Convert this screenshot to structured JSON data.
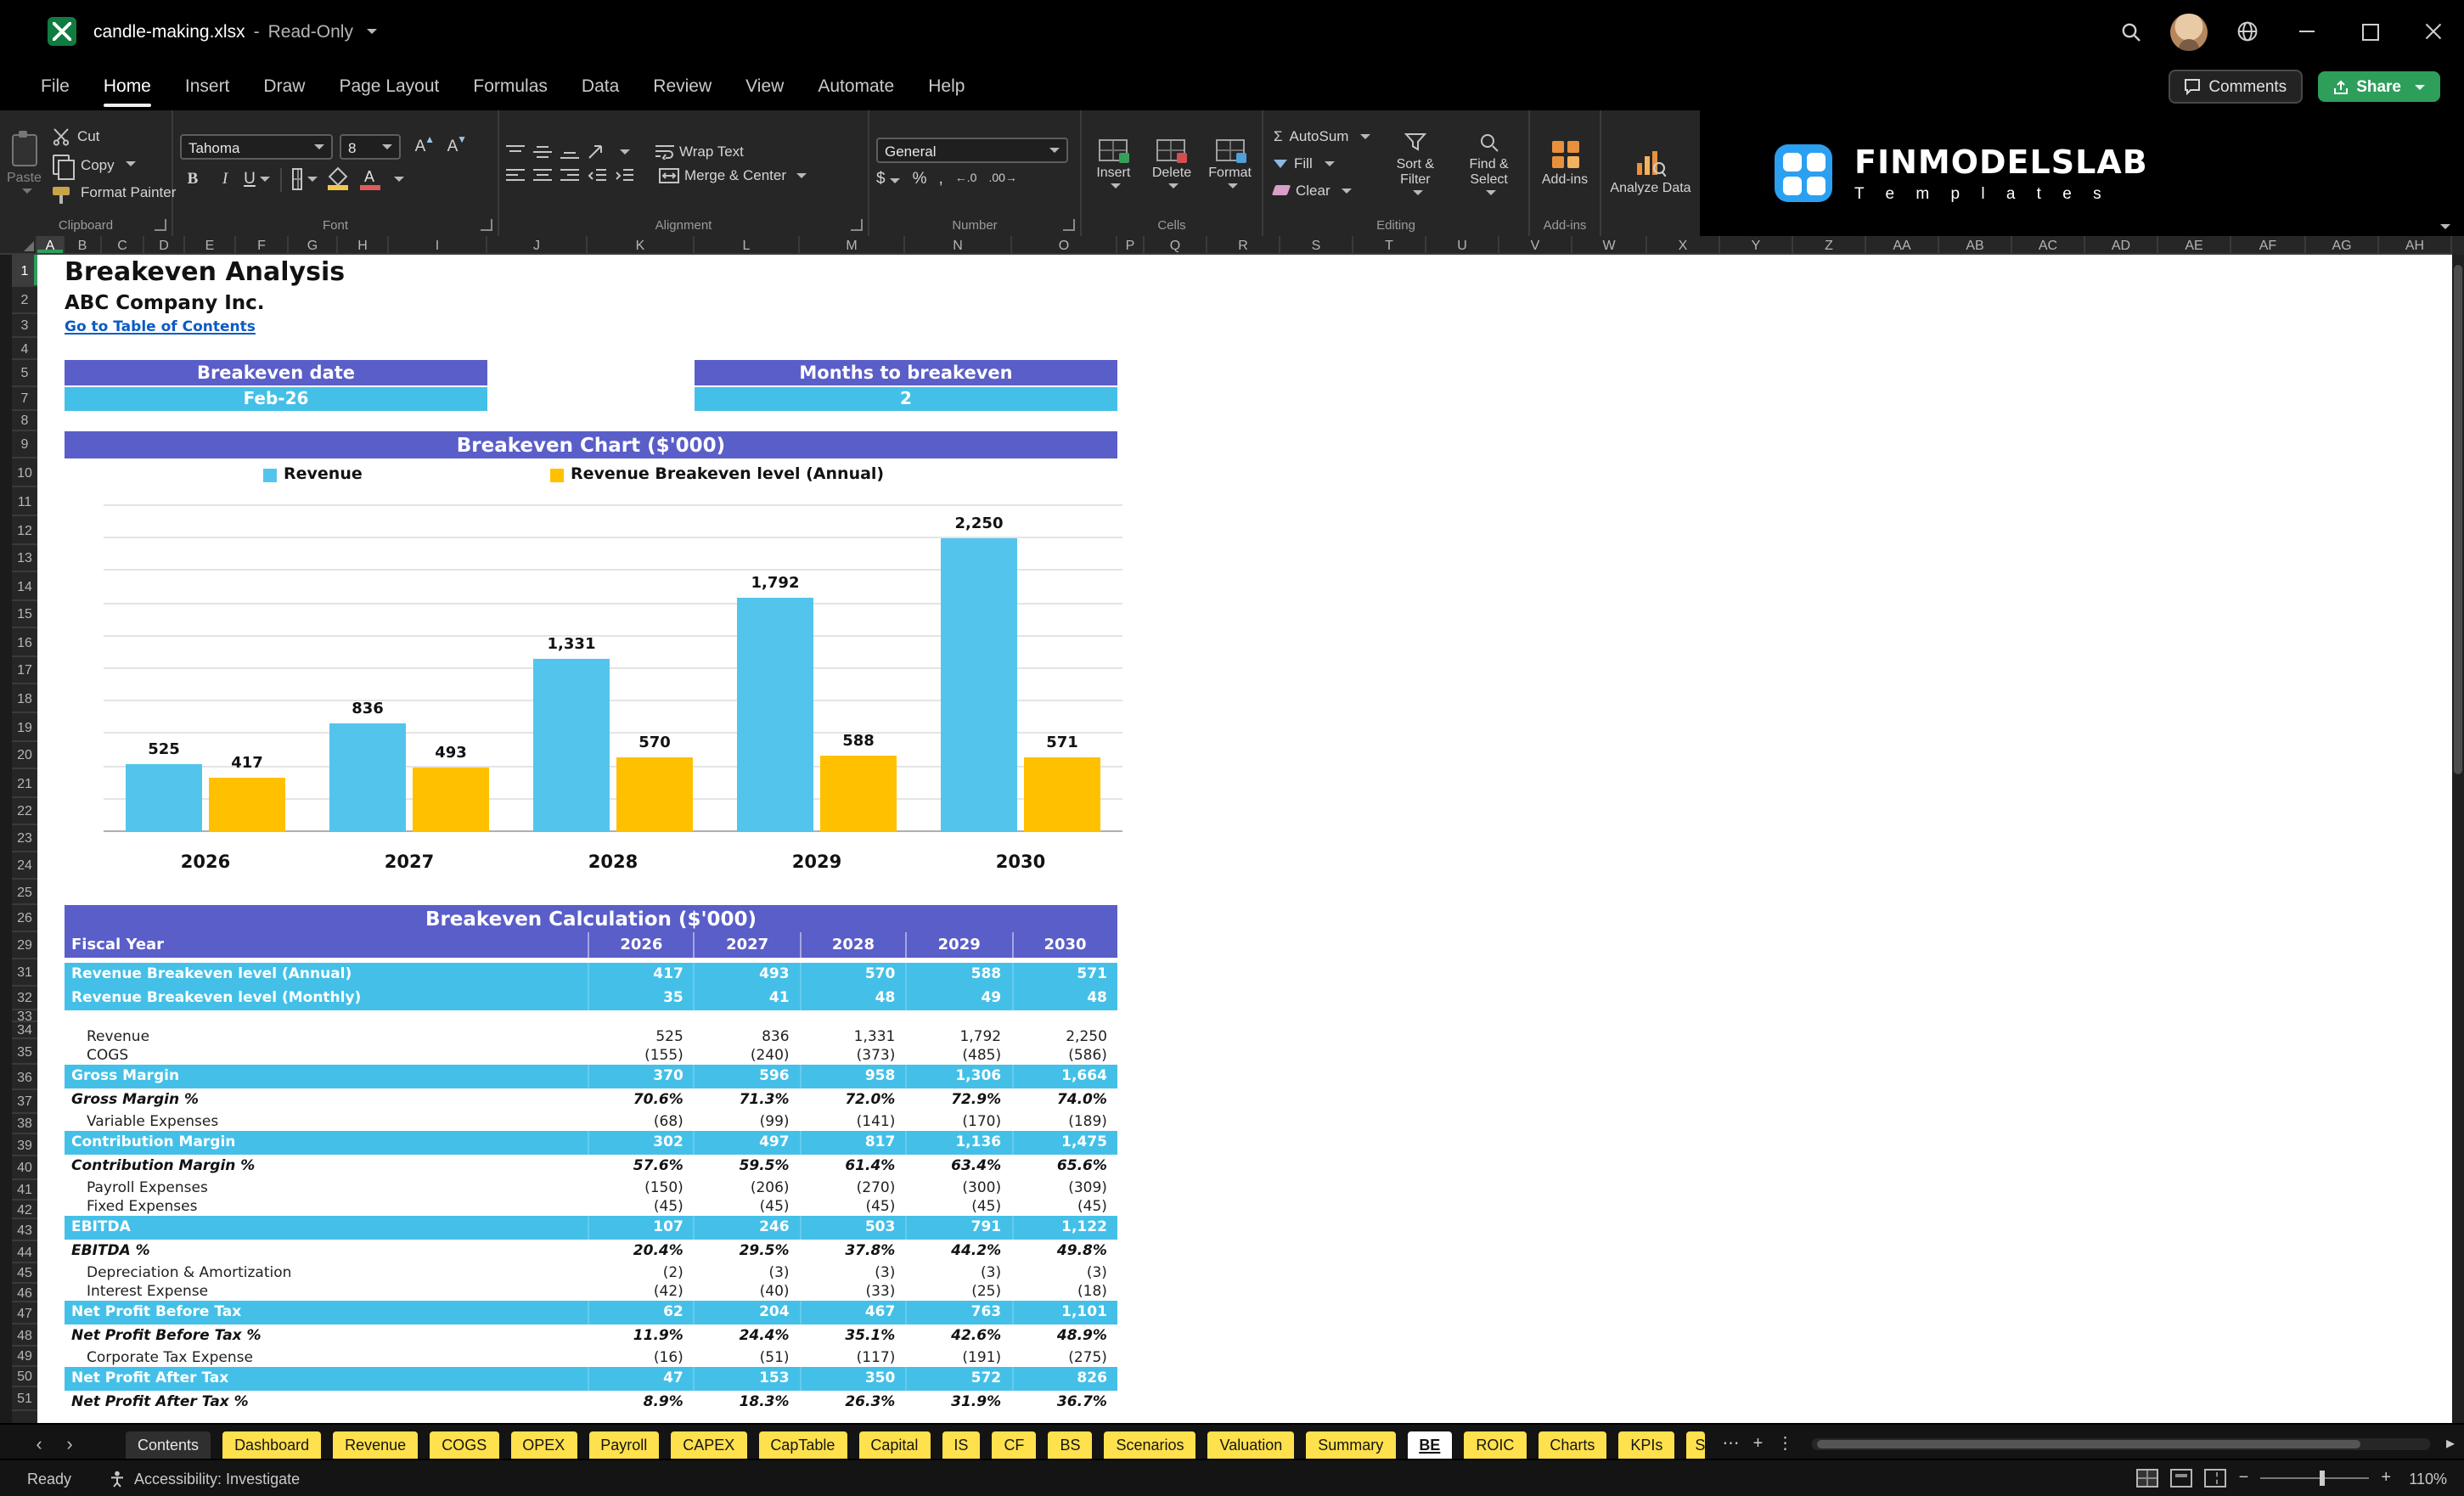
{
  "window": {
    "title": "candle-making.xlsx",
    "separator": "-",
    "mode": "Read-Only"
  },
  "menu": {
    "items": [
      "File",
      "Home",
      "Insert",
      "Draw",
      "Page Layout",
      "Formulas",
      "Data",
      "Review",
      "View",
      "Automate",
      "Help"
    ],
    "active": "Home",
    "comments": "Comments",
    "share": "Share"
  },
  "ribbon": {
    "clipboard": {
      "label": "Clipboard",
      "paste": "Paste",
      "cut": "Cut",
      "copy": "Copy",
      "format_painter": "Format Painter"
    },
    "font": {
      "label": "Font",
      "name": "Tahoma",
      "size": "8",
      "bold": "B",
      "italic": "I",
      "underline": "U",
      "grow": "A",
      "shrink": "A",
      "color_letter": "A"
    },
    "alignment": {
      "label": "Alignment",
      "wrap": "Wrap Text",
      "merge": "Merge & Center"
    },
    "number": {
      "label": "Number",
      "format": "General",
      "currency": "$",
      "percent": "%",
      "comma": ",",
      "dec_increase": "←.0",
      "dec_decrease": ".00→"
    },
    "cells": {
      "label": "Cells",
      "insert": "Insert",
      "delete": "Delete",
      "format": "Format"
    },
    "editing": {
      "label": "Editing",
      "autosum_symbol": "Σ",
      "autosum": "AutoSum",
      "fill": "Fill",
      "clear": "Clear",
      "sort_filter": "Sort & Filter",
      "find_select": "Find & Select"
    },
    "addins": {
      "label": "Add-ins"
    },
    "analyze": {
      "label": "Analyze Data"
    }
  },
  "brand": {
    "name": "FINMODELSLAB",
    "subtitle": "T e m p l a t e s"
  },
  "grid": {
    "columns": [
      "A",
      "B",
      "C",
      "D",
      "E",
      "F",
      "G",
      "H",
      "I",
      "J",
      "K",
      "L",
      "M",
      "N",
      "O",
      "P",
      "Q",
      "R",
      "S",
      "T",
      "U",
      "V",
      "W",
      "X",
      "Y",
      "Z",
      "AA",
      "AB",
      "AC",
      "AD",
      "AE",
      "AF",
      "AG",
      "AH"
    ],
    "rows": [
      1,
      2,
      3,
      4,
      5,
      7,
      8,
      9,
      10,
      11,
      12,
      13,
      14,
      15,
      16,
      17,
      18,
      19,
      20,
      21,
      22,
      23,
      24,
      25,
      26,
      29,
      31,
      32,
      33,
      34,
      35,
      36,
      37,
      38,
      39,
      40,
      41,
      42,
      43,
      44,
      45,
      46,
      47,
      48,
      49,
      50,
      51
    ]
  },
  "sheet": {
    "title": "Breakeven Analysis",
    "company": "ABC Company Inc.",
    "link": "Go to Table of Contents",
    "kpi1": {
      "label": "Breakeven date",
      "value": "Feb-26"
    },
    "kpi2": {
      "label": "Months to breakeven",
      "value": "2"
    },
    "calc_title": "Breakeven Calculation ($'000)"
  },
  "chart_data": {
    "type": "bar",
    "title": "Breakeven Chart ($'000)",
    "categories": [
      "2026",
      "2027",
      "2028",
      "2029",
      "2030"
    ],
    "series": [
      {
        "name": "Revenue",
        "color": "#53c5ec",
        "values": [
          525,
          836,
          1331,
          1792,
          2250
        ],
        "labels": [
          "525",
          "836",
          "1,331",
          "1,792",
          "2,250"
        ]
      },
      {
        "name": "Revenue Breakeven level (Annual)",
        "color": "#ffc000",
        "values": [
          417,
          493,
          570,
          588,
          571
        ],
        "labels": [
          "417",
          "493",
          "570",
          "588",
          "571"
        ]
      }
    ],
    "xlabel": "",
    "ylabel": "",
    "ylim": [
      0,
      2500
    ],
    "gridline_step": 250,
    "grid": true,
    "legend_position": "top"
  },
  "table": {
    "header": {
      "label": "Fiscal Year",
      "years": [
        "2026",
        "2027",
        "2028",
        "2029",
        "2030"
      ]
    },
    "rows": [
      {
        "label": "Revenue Breakeven level (Annual)",
        "values": [
          "417",
          "493",
          "570",
          "588",
          "571"
        ],
        "style": "highlight"
      },
      {
        "label": "Revenue Breakeven level (Monthly)",
        "values": [
          "35",
          "41",
          "48",
          "49",
          "48"
        ],
        "style": "highlight"
      },
      {
        "label": "",
        "values": [],
        "style": "spacer"
      },
      {
        "label": "Revenue",
        "values": [
          "525",
          "836",
          "1,331",
          "1,792",
          "2,250"
        ],
        "style": "item"
      },
      {
        "label": "COGS",
        "values": [
          "(155)",
          "(240)",
          "(373)",
          "(485)",
          "(586)"
        ],
        "style": "item"
      },
      {
        "label": "Gross Margin",
        "values": [
          "370",
          "596",
          "958",
          "1,306",
          "1,664"
        ],
        "style": "total"
      },
      {
        "label": "Gross Margin %",
        "values": [
          "70.6%",
          "71.3%",
          "72.0%",
          "72.9%",
          "74.0%"
        ],
        "style": "percent"
      },
      {
        "label": "Variable Expenses",
        "values": [
          "(68)",
          "(99)",
          "(141)",
          "(170)",
          "(189)"
        ],
        "style": "item"
      },
      {
        "label": "Contribution Margin",
        "values": [
          "302",
          "497",
          "817",
          "1,136",
          "1,475"
        ],
        "style": "total"
      },
      {
        "label": "Contribution Margin %",
        "values": [
          "57.6%",
          "59.5%",
          "61.4%",
          "63.4%",
          "65.6%"
        ],
        "style": "percent"
      },
      {
        "label": "Payroll Expenses",
        "values": [
          "(150)",
          "(206)",
          "(270)",
          "(300)",
          "(309)"
        ],
        "style": "item"
      },
      {
        "label": "Fixed Expenses",
        "values": [
          "(45)",
          "(45)",
          "(45)",
          "(45)",
          "(45)"
        ],
        "style": "item"
      },
      {
        "label": "EBITDA",
        "values": [
          "107",
          "246",
          "503",
          "791",
          "1,122"
        ],
        "style": "total"
      },
      {
        "label": "EBITDA %",
        "values": [
          "20.4%",
          "29.5%",
          "37.8%",
          "44.2%",
          "49.8%"
        ],
        "style": "percent"
      },
      {
        "label": "Depreciation & Amortization",
        "values": [
          "(2)",
          "(3)",
          "(3)",
          "(3)",
          "(3)"
        ],
        "style": "item"
      },
      {
        "label": "Interest Expense",
        "values": [
          "(42)",
          "(40)",
          "(33)",
          "(25)",
          "(18)"
        ],
        "style": "item"
      },
      {
        "label": "Net Profit Before Tax",
        "values": [
          "62",
          "204",
          "467",
          "763",
          "1,101"
        ],
        "style": "total"
      },
      {
        "label": "Net Profit Before Tax %",
        "values": [
          "11.9%",
          "24.4%",
          "35.1%",
          "42.6%",
          "48.9%"
        ],
        "style": "percent"
      },
      {
        "label": "Corporate Tax Expense",
        "values": [
          "(16)",
          "(51)",
          "(117)",
          "(191)",
          "(275)"
        ],
        "style": "item"
      },
      {
        "label": "Net Profit After Tax",
        "values": [
          "47",
          "153",
          "350",
          "572",
          "826"
        ],
        "style": "total"
      },
      {
        "label": "Net Profit After Tax %",
        "values": [
          "8.9%",
          "18.3%",
          "26.3%",
          "31.9%",
          "36.7%"
        ],
        "style": "percent"
      }
    ]
  },
  "tabs": {
    "prev": "‹",
    "next": "›",
    "items": [
      {
        "label": "Contents",
        "style": "plain"
      },
      {
        "label": "Dashboard",
        "style": "yellow"
      },
      {
        "label": "Revenue",
        "style": "yellow"
      },
      {
        "label": "COGS",
        "style": "yellow"
      },
      {
        "label": "OPEX",
        "style": "yellow"
      },
      {
        "label": "Payroll",
        "style": "yellow"
      },
      {
        "label": "CAPEX",
        "style": "yellow"
      },
      {
        "label": "CapTable",
        "style": "yellow"
      },
      {
        "label": "Capital",
        "style": "yellow"
      },
      {
        "label": "IS",
        "style": "yellow"
      },
      {
        "label": "CF",
        "style": "yellow"
      },
      {
        "label": "BS",
        "style": "yellow"
      },
      {
        "label": "Scenarios",
        "style": "yellow"
      },
      {
        "label": "Valuation",
        "style": "yellow"
      },
      {
        "label": "Summary",
        "style": "yellow"
      },
      {
        "label": "BE",
        "style": "active"
      },
      {
        "label": "ROIC",
        "style": "yellow"
      },
      {
        "label": "Charts",
        "style": "yellow"
      },
      {
        "label": "KPIs",
        "style": "yellow"
      },
      {
        "label": "S",
        "style": "yellow partial"
      }
    ],
    "more": "⋯",
    "add": "+",
    "options": "⋮",
    "scroll_right": "▸"
  },
  "status": {
    "ready": "Ready",
    "accessibility": "Accessibility: Investigate",
    "zoom_out": "−",
    "zoom_in": "+",
    "zoom": "110%"
  },
  "colors": {
    "header_purple": "#5a5ec8",
    "highlight_cyan": "#44c0e8",
    "chart_blue": "#53c5ec",
    "chart_yellow": "#ffc000",
    "tab_yellow": "#ffe14d",
    "link_blue": "#0a5bc4",
    "share_green": "#2e9e5b",
    "brand_blue": "#2b9ff0"
  }
}
